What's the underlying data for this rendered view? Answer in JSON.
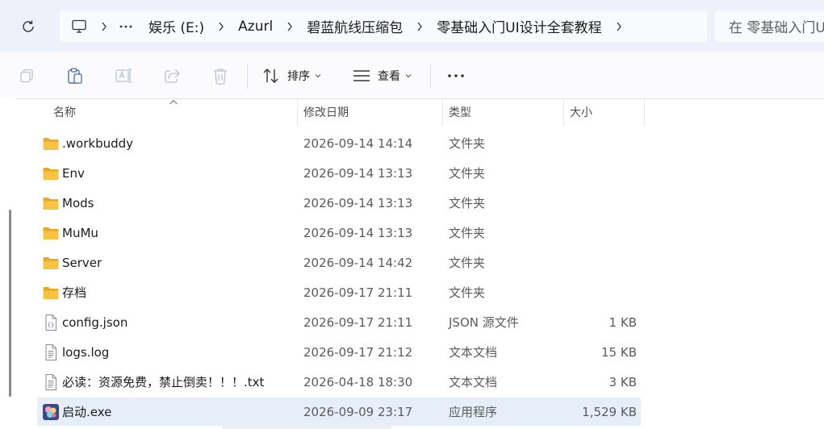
{
  "address_bar": {
    "breadcrumb": [
      "娱乐 (E:)",
      "Azurl",
      "碧蓝航线压缩包",
      "零基础入门UI设计全套教程"
    ],
    "search_placeholder": "在 零基础入门UI"
  },
  "toolbar": {
    "sort_label": "排序",
    "view_label": "查看"
  },
  "columns": {
    "name": "名称",
    "date": "修改日期",
    "type": "类型",
    "size": "大小"
  },
  "files": [
    {
      "name": ".workbuddy",
      "date": "2026-09-14 14:14",
      "type": "文件夹",
      "size": "",
      "icon": "folder-icon"
    },
    {
      "name": "Env",
      "date": "2026-09-14 13:13",
      "type": "文件夹",
      "size": "",
      "icon": "folder-icon"
    },
    {
      "name": "Mods",
      "date": "2026-09-14 13:13",
      "type": "文件夹",
      "size": "",
      "icon": "folder-icon"
    },
    {
      "name": "MuMu",
      "date": "2026-09-14 13:13",
      "type": "文件夹",
      "size": "",
      "icon": "folder-icon"
    },
    {
      "name": "Server",
      "date": "2026-09-14 14:42",
      "type": "文件夹",
      "size": "",
      "icon": "folder-icon"
    },
    {
      "name": "存档",
      "date": "2026-09-17 21:11",
      "type": "文件夹",
      "size": "",
      "icon": "folder-icon"
    },
    {
      "name": "config.json",
      "date": "2026-09-17 21:11",
      "type": "JSON 源文件",
      "size": "1 KB",
      "icon": "json-file-icon"
    },
    {
      "name": "logs.log",
      "date": "2026-09-17 21:12",
      "type": "文本文档",
      "size": "15 KB",
      "icon": "text-file-icon"
    },
    {
      "name": "必读：资源免费，禁止倒卖！！！.txt",
      "date": "2026-04-18 18:30",
      "type": "文本文档",
      "size": "3 KB",
      "icon": "text-file-icon"
    },
    {
      "name": "启动.exe",
      "date": "2026-09-09 23:17",
      "type": "应用程序",
      "size": "1,529 KB",
      "icon": "exe-app-icon",
      "selected": true
    }
  ],
  "colors": {
    "address_bg": "#eef1f9",
    "selected_row": "#e6eefa",
    "folder": "#f6c342"
  }
}
